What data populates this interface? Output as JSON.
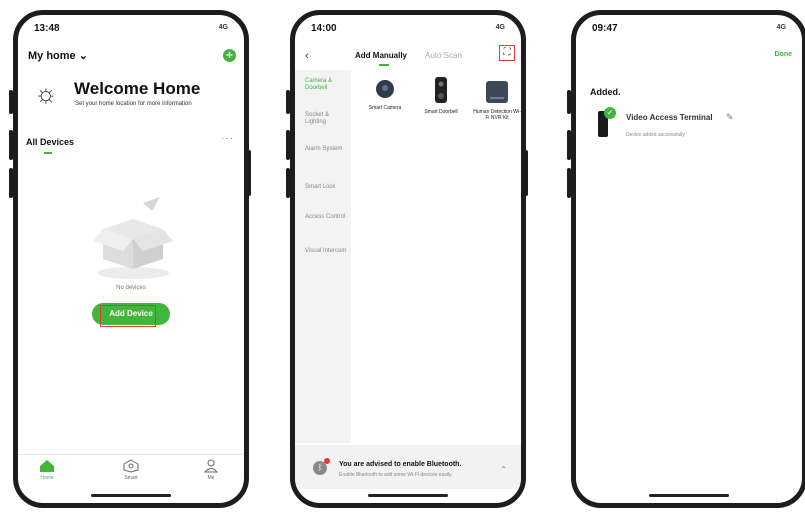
{
  "screen1": {
    "status_time": "13:48",
    "status_signal": "4G",
    "home_name": "My home",
    "home_chevron": "⌄",
    "plus_label": "+",
    "welcome": "Welcome Home",
    "set_location": "Set your home location for more information",
    "all_devices": "All Devices",
    "more_dots": "···",
    "no_devices": "No devices",
    "add_device": "Add Device",
    "tabs": [
      {
        "label": "Home",
        "icon": "home-icon"
      },
      {
        "label": "Smart",
        "icon": "smart-icon"
      },
      {
        "label": "Me",
        "icon": "user-icon"
      }
    ],
    "accent": "#43b53d"
  },
  "screen2": {
    "status_time": "14:00",
    "status_signal": "4G",
    "back": "‹",
    "tab_manual": "Add Manually",
    "tab_auto": "Auto Scan",
    "categories": [
      "Camera & Doorbell",
      "Socket & Lighting",
      "Alarm System",
      "Smart Lock",
      "Access Control",
      "Visual Intercom"
    ],
    "products": [
      {
        "name": "Smart Camera",
        "icon": "camera-icon"
      },
      {
        "name": "Smart Doorbell",
        "icon": "doorbell-icon"
      },
      {
        "name": "Human Detection Wi-Fi NVR Kit",
        "icon": "nvr-icon"
      }
    ],
    "bluetooth_title": "You are advised to enable Bluetooth.",
    "bluetooth_sub": "Enable Bluetooth to add some Wi-Fi devices easily.",
    "bluetooth_chevron": "⌃"
  },
  "screen3": {
    "status_time": "09:47",
    "status_signal": "4G",
    "done": "Done",
    "added": "Added.",
    "device_name": "Video Access Terminal",
    "device_status": "Device added successfully",
    "check": "✓",
    "pencil": "✎"
  }
}
